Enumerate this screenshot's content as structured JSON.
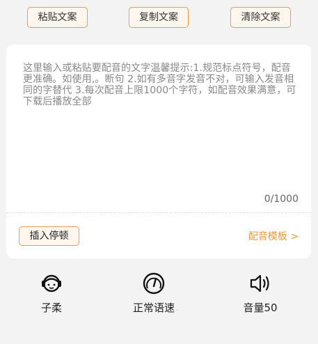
{
  "toolbar": {
    "paste_label": "粘贴文案",
    "copy_label": "复制文案",
    "clear_label": "清除文案"
  },
  "editor": {
    "placeholder": "这里输入或粘贴要配音的文字温馨提示:1.规范标点符号，配音更准确。如使用,。断句 2.如有多音字发音不对，可输入发音相同的字替代 3.每次配音上限1000个字符，如配音效果满意，可下载后播放全部",
    "char_count": "0/1000",
    "insert_pause_label": "插入停顿",
    "template_link": "配音模板 >"
  },
  "bottom": {
    "voice": {
      "label": "子柔",
      "icon": "headset-avatar-icon"
    },
    "speed": {
      "label": "正常语速",
      "icon": "speedometer-icon"
    },
    "volume": {
      "label": "音量50",
      "icon": "speaker-icon"
    }
  },
  "colors": {
    "accent": "#f2994a",
    "accent_text": "#f29a3a",
    "background": "#f3f3f3",
    "card": "#ffffff"
  }
}
